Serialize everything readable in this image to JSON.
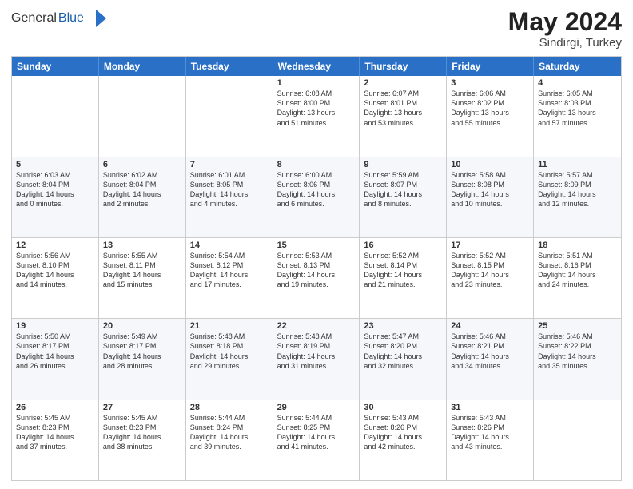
{
  "header": {
    "logo_general": "General",
    "logo_blue": "Blue",
    "month_year": "May 2024",
    "location": "Sindirgi, Turkey"
  },
  "days_of_week": [
    "Sunday",
    "Monday",
    "Tuesday",
    "Wednesday",
    "Thursday",
    "Friday",
    "Saturday"
  ],
  "rows": [
    {
      "alt": false,
      "cells": [
        {
          "day": "",
          "lines": []
        },
        {
          "day": "",
          "lines": []
        },
        {
          "day": "",
          "lines": []
        },
        {
          "day": "1",
          "lines": [
            "Sunrise: 6:08 AM",
            "Sunset: 8:00 PM",
            "Daylight: 13 hours",
            "and 51 minutes."
          ]
        },
        {
          "day": "2",
          "lines": [
            "Sunrise: 6:07 AM",
            "Sunset: 8:01 PM",
            "Daylight: 13 hours",
            "and 53 minutes."
          ]
        },
        {
          "day": "3",
          "lines": [
            "Sunrise: 6:06 AM",
            "Sunset: 8:02 PM",
            "Daylight: 13 hours",
            "and 55 minutes."
          ]
        },
        {
          "day": "4",
          "lines": [
            "Sunrise: 6:05 AM",
            "Sunset: 8:03 PM",
            "Daylight: 13 hours",
            "and 57 minutes."
          ]
        }
      ]
    },
    {
      "alt": true,
      "cells": [
        {
          "day": "5",
          "lines": [
            "Sunrise: 6:03 AM",
            "Sunset: 8:04 PM",
            "Daylight: 14 hours",
            "and 0 minutes."
          ]
        },
        {
          "day": "6",
          "lines": [
            "Sunrise: 6:02 AM",
            "Sunset: 8:04 PM",
            "Daylight: 14 hours",
            "and 2 minutes."
          ]
        },
        {
          "day": "7",
          "lines": [
            "Sunrise: 6:01 AM",
            "Sunset: 8:05 PM",
            "Daylight: 14 hours",
            "and 4 minutes."
          ]
        },
        {
          "day": "8",
          "lines": [
            "Sunrise: 6:00 AM",
            "Sunset: 8:06 PM",
            "Daylight: 14 hours",
            "and 6 minutes."
          ]
        },
        {
          "day": "9",
          "lines": [
            "Sunrise: 5:59 AM",
            "Sunset: 8:07 PM",
            "Daylight: 14 hours",
            "and 8 minutes."
          ]
        },
        {
          "day": "10",
          "lines": [
            "Sunrise: 5:58 AM",
            "Sunset: 8:08 PM",
            "Daylight: 14 hours",
            "and 10 minutes."
          ]
        },
        {
          "day": "11",
          "lines": [
            "Sunrise: 5:57 AM",
            "Sunset: 8:09 PM",
            "Daylight: 14 hours",
            "and 12 minutes."
          ]
        }
      ]
    },
    {
      "alt": false,
      "cells": [
        {
          "day": "12",
          "lines": [
            "Sunrise: 5:56 AM",
            "Sunset: 8:10 PM",
            "Daylight: 14 hours",
            "and 14 minutes."
          ]
        },
        {
          "day": "13",
          "lines": [
            "Sunrise: 5:55 AM",
            "Sunset: 8:11 PM",
            "Daylight: 14 hours",
            "and 15 minutes."
          ]
        },
        {
          "day": "14",
          "lines": [
            "Sunrise: 5:54 AM",
            "Sunset: 8:12 PM",
            "Daylight: 14 hours",
            "and 17 minutes."
          ]
        },
        {
          "day": "15",
          "lines": [
            "Sunrise: 5:53 AM",
            "Sunset: 8:13 PM",
            "Daylight: 14 hours",
            "and 19 minutes."
          ]
        },
        {
          "day": "16",
          "lines": [
            "Sunrise: 5:52 AM",
            "Sunset: 8:14 PM",
            "Daylight: 14 hours",
            "and 21 minutes."
          ]
        },
        {
          "day": "17",
          "lines": [
            "Sunrise: 5:52 AM",
            "Sunset: 8:15 PM",
            "Daylight: 14 hours",
            "and 23 minutes."
          ]
        },
        {
          "day": "18",
          "lines": [
            "Sunrise: 5:51 AM",
            "Sunset: 8:16 PM",
            "Daylight: 14 hours",
            "and 24 minutes."
          ]
        }
      ]
    },
    {
      "alt": true,
      "cells": [
        {
          "day": "19",
          "lines": [
            "Sunrise: 5:50 AM",
            "Sunset: 8:17 PM",
            "Daylight: 14 hours",
            "and 26 minutes."
          ]
        },
        {
          "day": "20",
          "lines": [
            "Sunrise: 5:49 AM",
            "Sunset: 8:17 PM",
            "Daylight: 14 hours",
            "and 28 minutes."
          ]
        },
        {
          "day": "21",
          "lines": [
            "Sunrise: 5:48 AM",
            "Sunset: 8:18 PM",
            "Daylight: 14 hours",
            "and 29 minutes."
          ]
        },
        {
          "day": "22",
          "lines": [
            "Sunrise: 5:48 AM",
            "Sunset: 8:19 PM",
            "Daylight: 14 hours",
            "and 31 minutes."
          ]
        },
        {
          "day": "23",
          "lines": [
            "Sunrise: 5:47 AM",
            "Sunset: 8:20 PM",
            "Daylight: 14 hours",
            "and 32 minutes."
          ]
        },
        {
          "day": "24",
          "lines": [
            "Sunrise: 5:46 AM",
            "Sunset: 8:21 PM",
            "Daylight: 14 hours",
            "and 34 minutes."
          ]
        },
        {
          "day": "25",
          "lines": [
            "Sunrise: 5:46 AM",
            "Sunset: 8:22 PM",
            "Daylight: 14 hours",
            "and 35 minutes."
          ]
        }
      ]
    },
    {
      "alt": false,
      "cells": [
        {
          "day": "26",
          "lines": [
            "Sunrise: 5:45 AM",
            "Sunset: 8:23 PM",
            "Daylight: 14 hours",
            "and 37 minutes."
          ]
        },
        {
          "day": "27",
          "lines": [
            "Sunrise: 5:45 AM",
            "Sunset: 8:23 PM",
            "Daylight: 14 hours",
            "and 38 minutes."
          ]
        },
        {
          "day": "28",
          "lines": [
            "Sunrise: 5:44 AM",
            "Sunset: 8:24 PM",
            "Daylight: 14 hours",
            "and 39 minutes."
          ]
        },
        {
          "day": "29",
          "lines": [
            "Sunrise: 5:44 AM",
            "Sunset: 8:25 PM",
            "Daylight: 14 hours",
            "and 41 minutes."
          ]
        },
        {
          "day": "30",
          "lines": [
            "Sunrise: 5:43 AM",
            "Sunset: 8:26 PM",
            "Daylight: 14 hours",
            "and 42 minutes."
          ]
        },
        {
          "day": "31",
          "lines": [
            "Sunrise: 5:43 AM",
            "Sunset: 8:26 PM",
            "Daylight: 14 hours",
            "and 43 minutes."
          ]
        },
        {
          "day": "",
          "lines": []
        }
      ]
    }
  ]
}
